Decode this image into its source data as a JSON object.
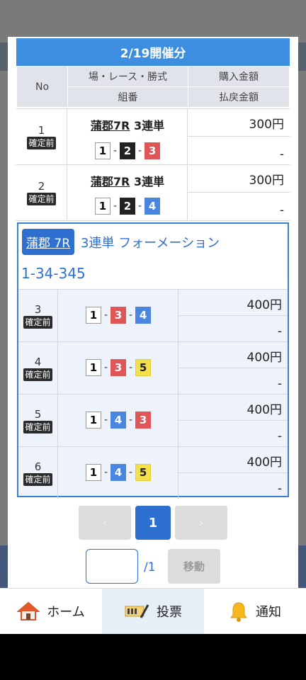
{
  "modal": {
    "title": "2/19開催分",
    "header": {
      "no": "No",
      "race_type": "場・レース・勝式",
      "purchase": "購入金額",
      "combo": "組番",
      "payout": "払戻金額"
    }
  },
  "status_label": "確定前",
  "bets": [
    {
      "no": "1",
      "venue": "蒲郡7R",
      "type": "3連単",
      "boats": [
        "1",
        "2",
        "3"
      ],
      "purchase": "300円",
      "payout": "-"
    },
    {
      "no": "2",
      "venue": "蒲郡7R",
      "type": "3連単",
      "boats": [
        "1",
        "2",
        "4"
      ],
      "purchase": "300円",
      "payout": "-"
    }
  ],
  "formation": {
    "venue": "蒲郡 7R",
    "type": "3連単 フォーメーション",
    "combo": "1-34-345",
    "rows": [
      {
        "no": "3",
        "boats": [
          "1",
          "3",
          "4"
        ],
        "purchase": "400円",
        "payout": "-"
      },
      {
        "no": "4",
        "boats": [
          "1",
          "3",
          "5"
        ],
        "purchase": "400円",
        "payout": "-"
      },
      {
        "no": "5",
        "boats": [
          "1",
          "4",
          "3"
        ],
        "purchase": "400円",
        "payout": "-"
      },
      {
        "no": "6",
        "boats": [
          "1",
          "4",
          "5"
        ],
        "purchase": "400円",
        "payout": "-"
      }
    ]
  },
  "pagination": {
    "prev": "‹",
    "current": "1",
    "next": "›",
    "page_input": "",
    "total": "/1",
    "move_button": "移動"
  },
  "tabbar": [
    {
      "label": "ホーム",
      "icon": "home-icon"
    },
    {
      "label": "投票",
      "icon": "ticket-icon",
      "active": true
    },
    {
      "label": "通知",
      "icon": "bell-icon"
    }
  ],
  "colors": {
    "accent": "#2f6fd0",
    "header": "#3d8ee0",
    "boat_1": "#ffffff",
    "boat_2": "#222222",
    "boat_3": "#e05656",
    "boat_4": "#4a86e0",
    "boat_5": "#f2e14c"
  }
}
